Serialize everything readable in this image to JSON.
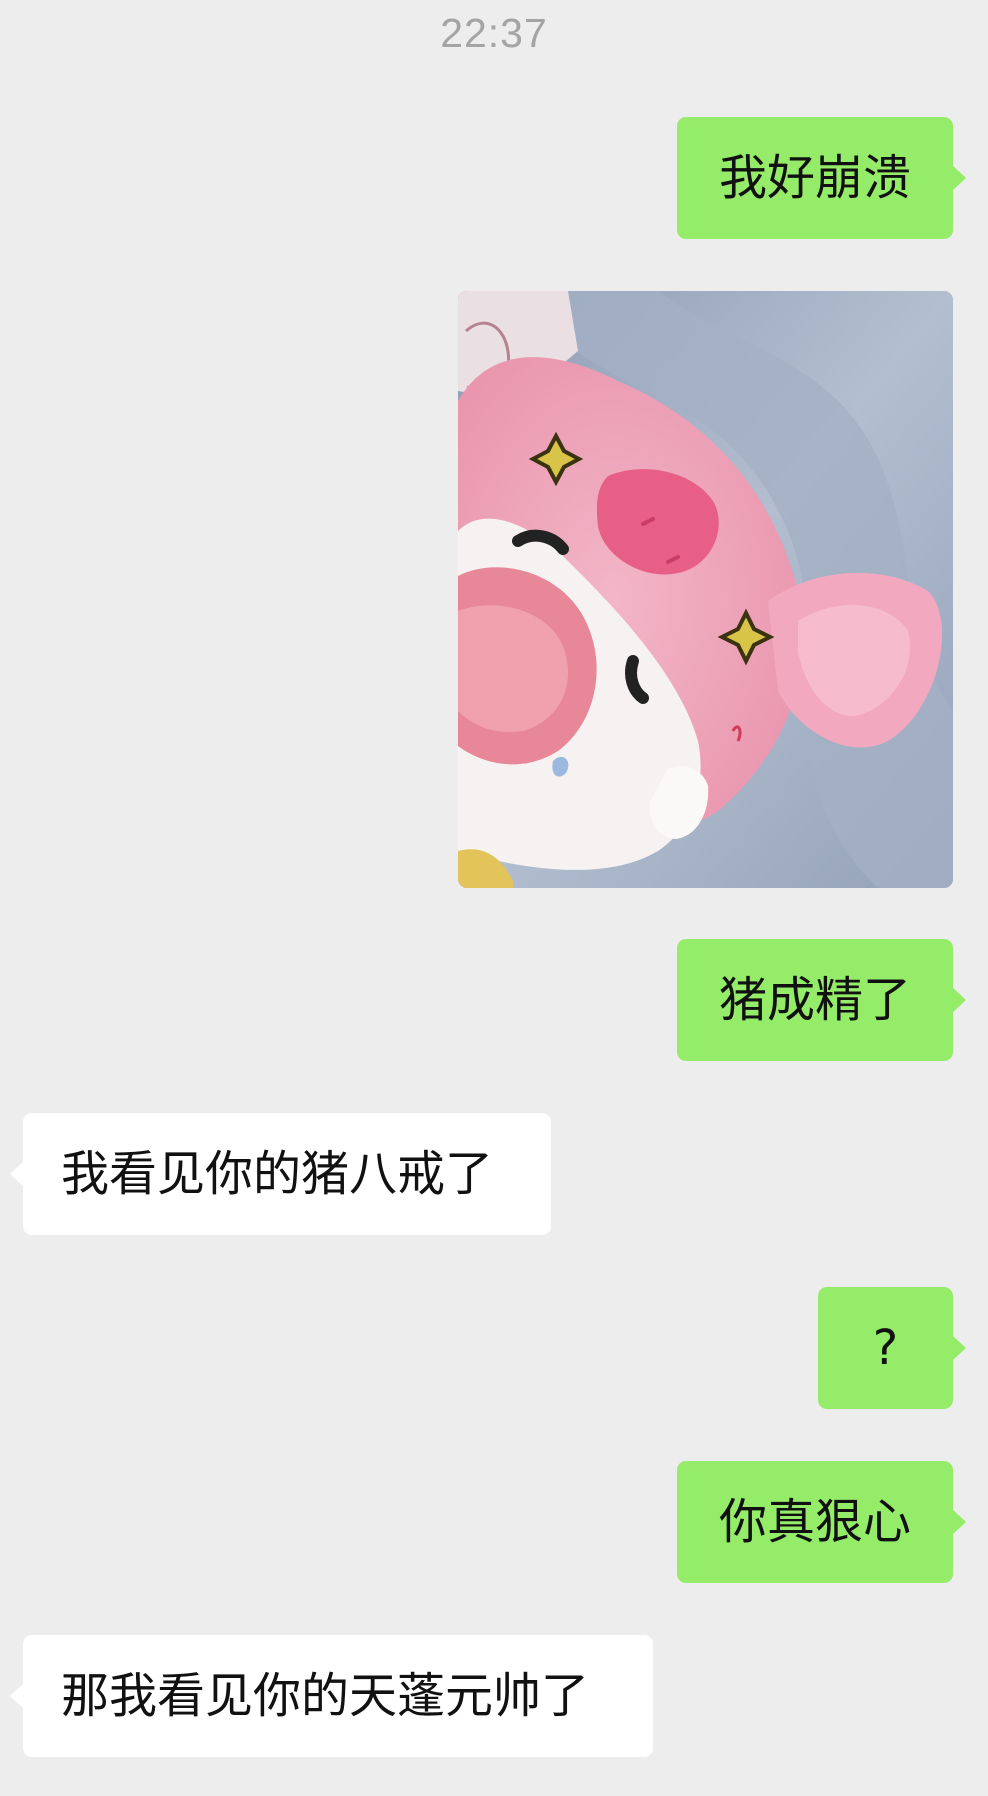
{
  "chat": {
    "timestamp": "22:37",
    "messages": [
      {
        "side": "me",
        "type": "text",
        "text": "我好崩溃"
      },
      {
        "side": "me",
        "type": "image",
        "description": "pink-pig-plush-photo"
      },
      {
        "side": "me",
        "type": "text",
        "text": "猪成精了"
      },
      {
        "side": "them",
        "type": "text",
        "text": "我看见你的猪八戒了"
      },
      {
        "side": "me",
        "type": "text",
        "text": "?"
      },
      {
        "side": "me",
        "type": "text",
        "text": "你真狠心"
      },
      {
        "side": "them",
        "type": "text",
        "text": "那我看见你的天蓬元帅了"
      }
    ]
  },
  "colors": {
    "background": "#ededed",
    "outgoing_bubble": "#95ec69",
    "incoming_bubble": "#ffffff",
    "timestamp_text": "#a4a4a4",
    "message_text": "#111111"
  }
}
